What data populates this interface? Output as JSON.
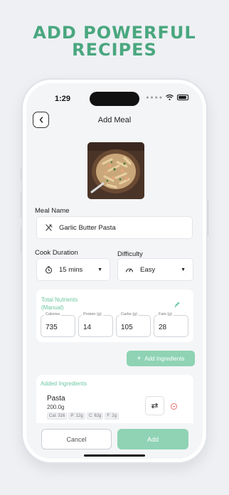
{
  "promo": {
    "headline_line1": "ADD POWERFUL",
    "headline_line2": "RECIPES"
  },
  "status_bar": {
    "time": "1:29"
  },
  "header": {
    "title": "Add Meal",
    "back_icon": "chevron-left-icon"
  },
  "meal_name": {
    "label": "Meal Name",
    "value": "Garlic Butter Pasta",
    "icon": "utensils-icon"
  },
  "cook_duration": {
    "label": "Cook Duration",
    "value": "15 mins",
    "icon": "timer-icon"
  },
  "difficulty": {
    "label": "Difficulty",
    "value": "Easy",
    "icon": "gauge-icon"
  },
  "nutrients": {
    "title_line1": "Total Nutrients",
    "title_line2": "(Manual)",
    "edit_icon": "pencil-icon",
    "items": [
      {
        "label": "Calories",
        "value": "735"
      },
      {
        "label": "Protein (g)",
        "value": "14"
      },
      {
        "label": "Carbs (g)",
        "value": "105"
      },
      {
        "label": "Fats (g)",
        "value": "28"
      }
    ]
  },
  "add_ingredients_button": {
    "icon": "+",
    "label": "Add Ingredients"
  },
  "added_ingredients": {
    "title": "Added Ingredients",
    "items": [
      {
        "name": "Pasta",
        "quantity": "200.0g",
        "chips": [
          "Cal: 316",
          "P: 12g",
          "C: 62g",
          "F: 2g"
        ]
      }
    ]
  },
  "footer": {
    "cancel_label": "Cancel",
    "add_label": "Add"
  },
  "colors": {
    "accent": "#4aa77f",
    "button_green": "#8fd3b4",
    "danger": "#e57373"
  }
}
